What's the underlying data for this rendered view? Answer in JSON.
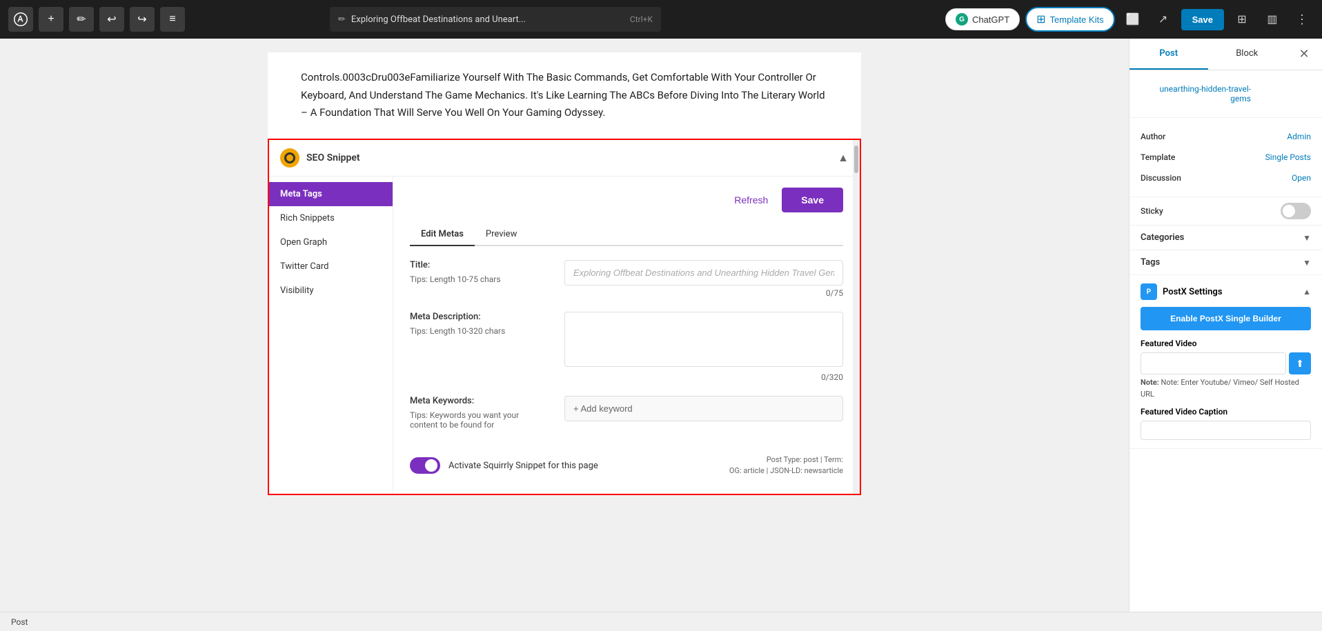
{
  "toolbar": {
    "post_title": "Exploring Offbeat Destinations and Uneart...",
    "shortcut": "Ctrl+K",
    "chatgpt_label": "ChatGPT",
    "template_kits_label": "Template Kits",
    "save_label": "Save"
  },
  "editor": {
    "content_text": "Controls.0003cDru003eFamiliarize Yourself With The Basic Commands, Get Comfortable With Your Controller Or Keyboard, And Understand The Game Mechanics. It's Like Learning The ABCs Before Diving Into The Literary World – A Foundation That Will Serve You Well On Your Gaming Odyssey."
  },
  "seo_panel": {
    "title": "SEO Snippet",
    "refresh_label": "Refresh",
    "save_label": "Save",
    "nav_items": [
      {
        "label": "Meta Tags",
        "active": true
      },
      {
        "label": "Rich Snippets",
        "active": false
      },
      {
        "label": "Open Graph",
        "active": false
      },
      {
        "label": "Twitter Card",
        "active": false
      },
      {
        "label": "Visibility",
        "active": false
      }
    ],
    "tabs": [
      {
        "label": "Edit Metas",
        "active": true
      },
      {
        "label": "Preview",
        "active": false
      }
    ],
    "title_label": "Title:",
    "title_placeholder": "Exploring Offbeat Destinations and Unearthing Hidden Travel Gems",
    "title_tip": "Tips: Length 10-75 chars",
    "title_count": "0/75",
    "meta_desc_label": "Meta Description:",
    "meta_desc_tip": "Tips: Length 10-320 chars",
    "meta_desc_count": "0/320",
    "meta_keywords_label": "Meta Keywords:",
    "meta_keywords_tip": "Tips: Keywords you want your content to be found for",
    "add_keyword_label": "+ Add keyword",
    "activate_label": "Activate Squirrly Snippet for this page",
    "post_type_info": "Post Type: post | Term:\nOG: article | JSON-LD: newsarticle"
  },
  "right_sidebar": {
    "post_tab": "Post",
    "block_tab": "Block",
    "url_label": "unearthing-hidden-travel-gems",
    "author_label": "Author",
    "author_value": "Admin",
    "template_label": "Template",
    "template_value": "Single Posts",
    "discussion_label": "Discussion",
    "discussion_value": "Open",
    "sticky_label": "Sticky",
    "categories_label": "Categories",
    "tags_label": "Tags",
    "postx_settings_label": "PostX Settings",
    "enable_postx_label": "Enable PostX Single Builder",
    "featured_video_label": "Featured Video",
    "video_note": "Note: Enter Youtube/ Vimeo/ Self Hosted URL",
    "featured_caption_label": "Featured Video Caption"
  },
  "status_bar": {
    "label": "Post"
  }
}
